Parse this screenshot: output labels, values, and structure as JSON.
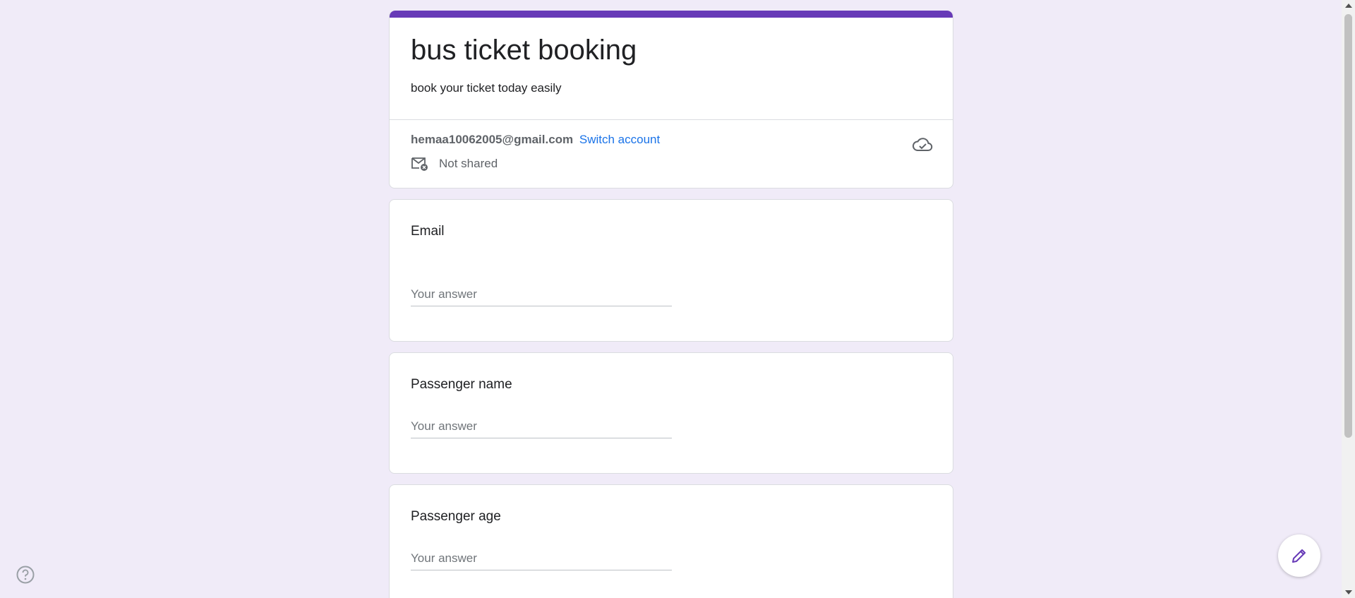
{
  "form": {
    "title": "bus ticket booking",
    "description": "book your ticket today easily",
    "accent_color": "#673ab7"
  },
  "account": {
    "email": "hemaa10062005@gmail.com",
    "switch_label": "Switch account",
    "shared_status": "Not shared",
    "sync_icon": "cloud-done-icon",
    "mail_icon": "mail-not-shared-icon"
  },
  "questions": [
    {
      "title": "Email",
      "placeholder": "Your answer",
      "value": ""
    },
    {
      "title": "Passenger name",
      "placeholder": "Your answer",
      "value": ""
    },
    {
      "title": "Passenger age",
      "placeholder": "Your answer",
      "value": ""
    }
  ],
  "floating": {
    "help_icon": "help-icon",
    "edit_icon": "pencil-icon"
  }
}
